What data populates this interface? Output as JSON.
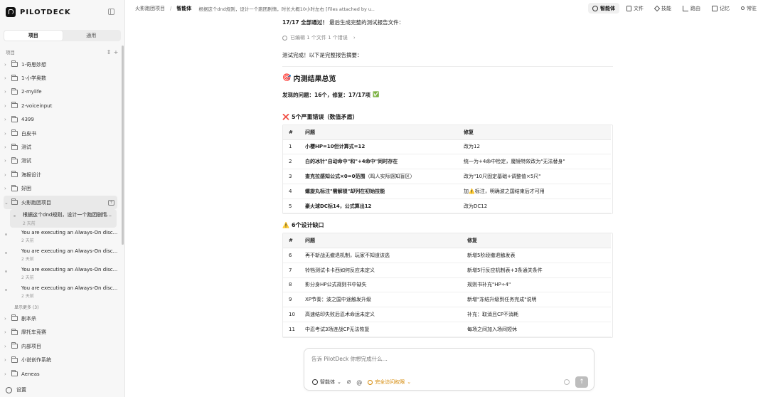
{
  "sidebar": {
    "brand": "PILOTDECK",
    "tabs": [
      "项目",
      "通用"
    ],
    "section_label": "项目",
    "items": [
      {
        "label": "1-奇思妙想"
      },
      {
        "label": "1-小学奥数"
      },
      {
        "label": "2-mylife"
      },
      {
        "label": "2-voiceinput"
      },
      {
        "label": "4399"
      },
      {
        "label": "白皮书"
      },
      {
        "label": "测试"
      },
      {
        "label": "测试"
      },
      {
        "label": "海报设计"
      },
      {
        "label": "好困"
      }
    ],
    "open_project": "火影跑团项目",
    "sessions": [
      {
        "title": "根据这个dnd规则，设计一个跑团剧情...",
        "time": "2 天前"
      },
      {
        "title": "You are executing an Always-On disc...",
        "time": "2 天前"
      },
      {
        "title": "You are executing an Always-On disc...",
        "time": "2 天前"
      },
      {
        "title": "You are executing an Always-On disc...",
        "time": "2 天前"
      },
      {
        "title": "You are executing an Always-On disc...",
        "time": "2 天前"
      }
    ],
    "show_more": "显示更多 (3)",
    "items_after": [
      {
        "label": "剧本杀"
      },
      {
        "label": "摩托车竞赛"
      },
      {
        "label": "内部项目"
      },
      {
        "label": "小说创作系统"
      },
      {
        "label": "Aeneas"
      }
    ],
    "settings": "设置"
  },
  "topbar": {
    "project": "火影跑团项目",
    "separator": "/",
    "current": "智能体",
    "query": "根据这个dnd规则，设计一个跑团剧情，时长大概10小时左右 [Files attached by u...",
    "tabs": [
      {
        "label": "智能体",
        "icon": "clock-icon"
      },
      {
        "label": "文件",
        "icon": "file-icon"
      },
      {
        "label": "技能",
        "icon": "skill-icon"
      },
      {
        "label": "路由",
        "icon": "route-icon"
      },
      {
        "label": "记忆",
        "icon": "note-icon"
      },
      {
        "label": "常驻",
        "icon": "radio-icon"
      }
    ]
  },
  "main": {
    "pass_line_bold": "17/17 全部通过！",
    "pass_line_rest": " 最后生成完整的测试报告文件：",
    "edit_summary": "已编辑 1 个文件 1 个错误",
    "done_line": "测试完成！以下是完整报告摘要：",
    "summary_title": "内测结果总览",
    "summary_emoji": "🎯",
    "found_line": "发现的问题：16个，修复：17/17项",
    "found_emoji": "✅",
    "severe_title": "5个严重错误（数值矛盾）",
    "severe_emoji": "❌",
    "severe_headers": [
      "#",
      "问题",
      "修复"
    ],
    "severe_rows": [
      {
        "n": "1",
        "issue": "小樱HP=10但计算式=12",
        "fix": "改为12"
      },
      {
        "n": "2",
        "issue": "白的冰针\"自动命中\"和\"+4命中\"同时存在",
        "fix": "统一为+4命中检定，魔镜特效改为\"无法替身\""
      },
      {
        "n": "3",
        "issue": "查克拉感知公式×0=0范围",
        "issue_note": "（鸣人实际感知盲区）",
        "fix": "改为\"10尺固定基础+调整值×5尺\""
      },
      {
        "n": "4",
        "issue": "螺旋丸标注\"需解锁\"却列在初始技能",
        "fix": "加⚠️标注，明确波之国结束后才可用"
      },
      {
        "n": "5",
        "issue": "豪火球DC标14，公式算出12",
        "fix": "改为DC12"
      }
    ],
    "design_title": "6个设计缺口",
    "design_emoji": "⚠️",
    "design_headers": [
      "#",
      "问题",
      "修复"
    ],
    "design_rows": [
      {
        "n": "6",
        "issue": "再不斩战无撤退机制，玩家不知道该逃",
        "fix": "新增5阶段撤退触发表"
      },
      {
        "n": "7",
        "issue": "铃铛测试卡卡西如何反应未定义",
        "fix": "新增5行反应机制表+3条通关条件"
      },
      {
        "n": "8",
        "issue": "影分身HP公式规则书中缺失",
        "fix": "规则书补充\"HP÷4\""
      },
      {
        "n": "9",
        "issue": "XP节奏：波之国中途触发升级",
        "fix": "新增\"冻结升级到任务完成\"说明"
      },
      {
        "n": "10",
        "issue": "高速结印失败后忍术命运未定义",
        "fix": "补充：取消且CP不消耗"
      },
      {
        "n": "11",
        "issue": "中忍考试3场连战CP无法恢复",
        "fix": "每场之间加入场间短休"
      }
    ]
  },
  "composer": {
    "placeholder": "告诉 PilotDeck 你想完成什么...",
    "agent_label": "智能体",
    "permission_label": "完全访问权限",
    "send_symbol": "↑"
  },
  "colors": {
    "accent_warn": "#d48806",
    "sidebar_bg": "#f7f7f7"
  }
}
